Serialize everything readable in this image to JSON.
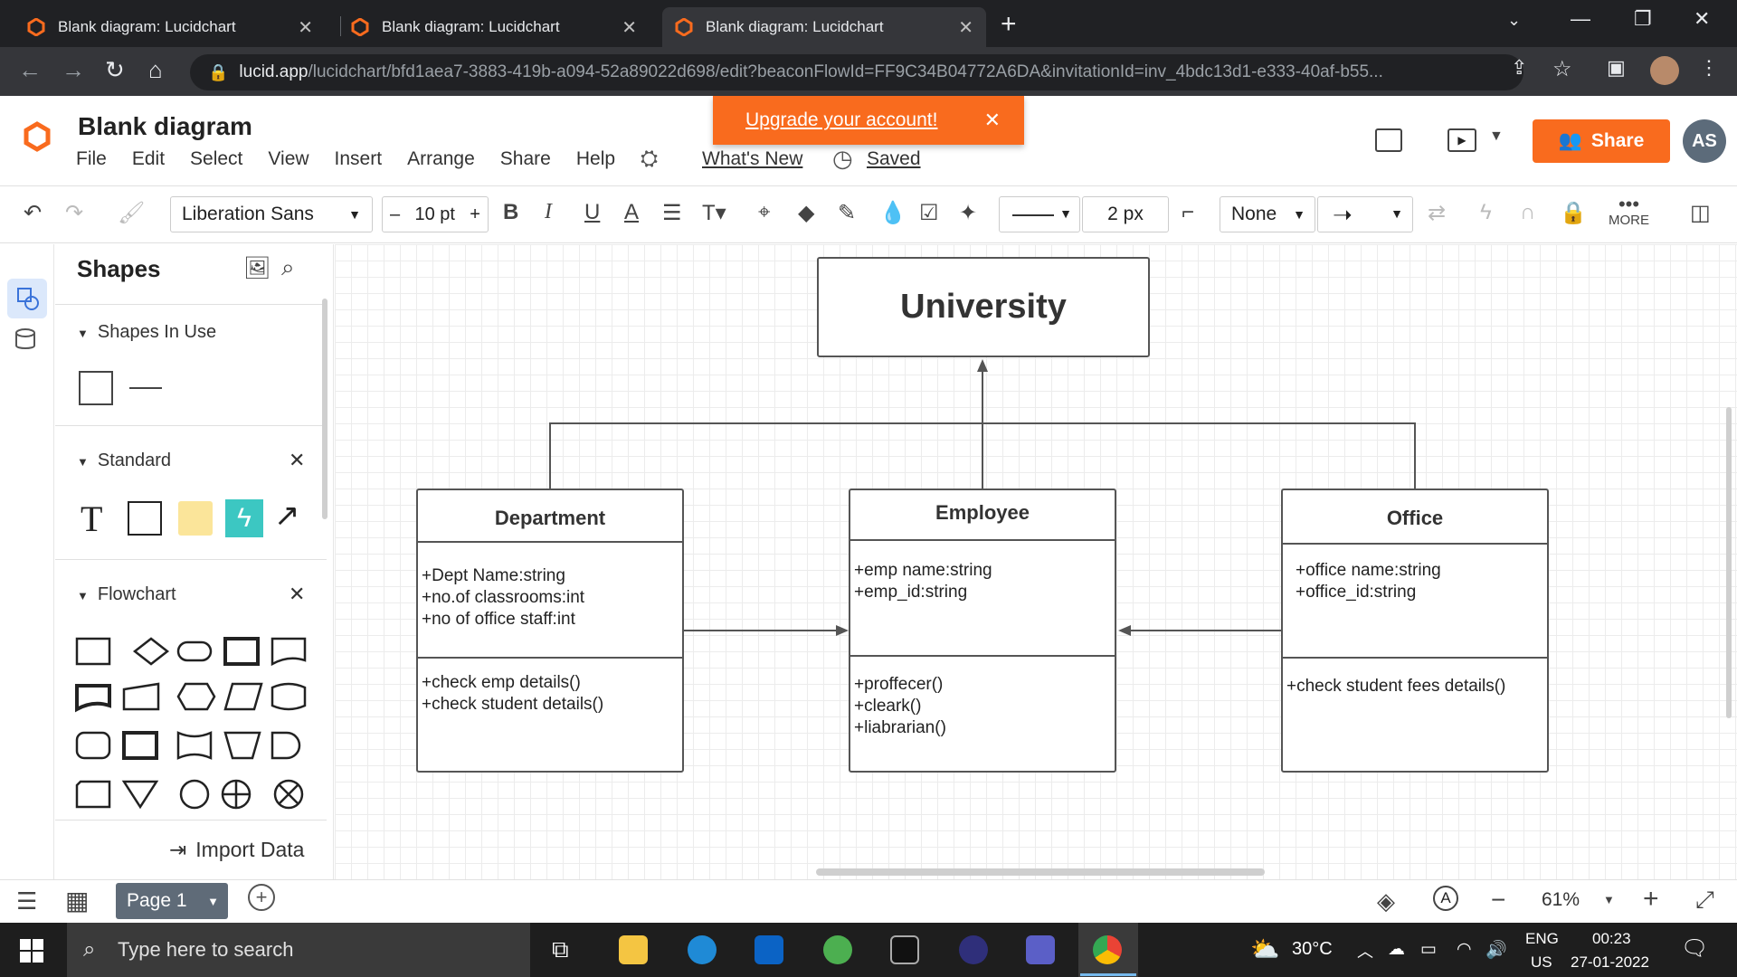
{
  "browser": {
    "tabs": [
      {
        "title": "Blank diagram: Lucidchart"
      },
      {
        "title": "Blank diagram: Lucidchart"
      },
      {
        "title": "Blank diagram: Lucidchart"
      }
    ],
    "url_host": "lucid.app",
    "url_path": "/lucidchart/bfd1aea7-3883-419b-a094-52a89022d698/edit?beaconFlowId=FF9C34B04772A6DA&invitationId=inv_4bdc13d1-e333-40af-b55..."
  },
  "header": {
    "doc_title": "Blank diagram",
    "menu": [
      "File",
      "Edit",
      "Select",
      "View",
      "Insert",
      "Arrange",
      "Share",
      "Help"
    ],
    "whats_new": "What's New",
    "saved": "Saved",
    "upgrade": "Upgrade your account!",
    "share": "Share",
    "user_initials": "AS"
  },
  "toolbar": {
    "font": "Liberation Sans",
    "font_size": "10 pt",
    "line_width": "2 px",
    "endpoint": "None",
    "more": "MORE"
  },
  "shapes_panel": {
    "title": "Shapes",
    "sections": [
      "Shapes In Use",
      "Standard",
      "Flowchart"
    ],
    "import": "Import Data"
  },
  "diagram": {
    "university": "University",
    "department": {
      "title": "Department",
      "attrs": [
        "+Dept Name:string",
        "+no.of classrooms:int",
        "+no of office staff:int"
      ],
      "methods": [
        "+check emp details()",
        "+check student details()"
      ]
    },
    "employee": {
      "title": "Employee",
      "attrs": [
        "+emp name:string",
        "+emp_id:string"
      ],
      "methods": [
        "+proffecer()",
        "+cleark()",
        "+liabrarian()"
      ]
    },
    "office": {
      "title": "Office",
      "attrs": [
        "+office name:string",
        "+office_id:string"
      ],
      "methods": [
        "+check student fees details()"
      ]
    }
  },
  "bottom": {
    "page": "Page 1",
    "zoom": "61%"
  },
  "taskbar": {
    "search_placeholder": "Type here to search",
    "temperature": "30°C",
    "lang1": "ENG",
    "lang2": "US",
    "time": "00:23",
    "date": "27-01-2022"
  },
  "colors": {
    "accent": "#f96b1e",
    "selected_rail": "#dbe8fb"
  }
}
